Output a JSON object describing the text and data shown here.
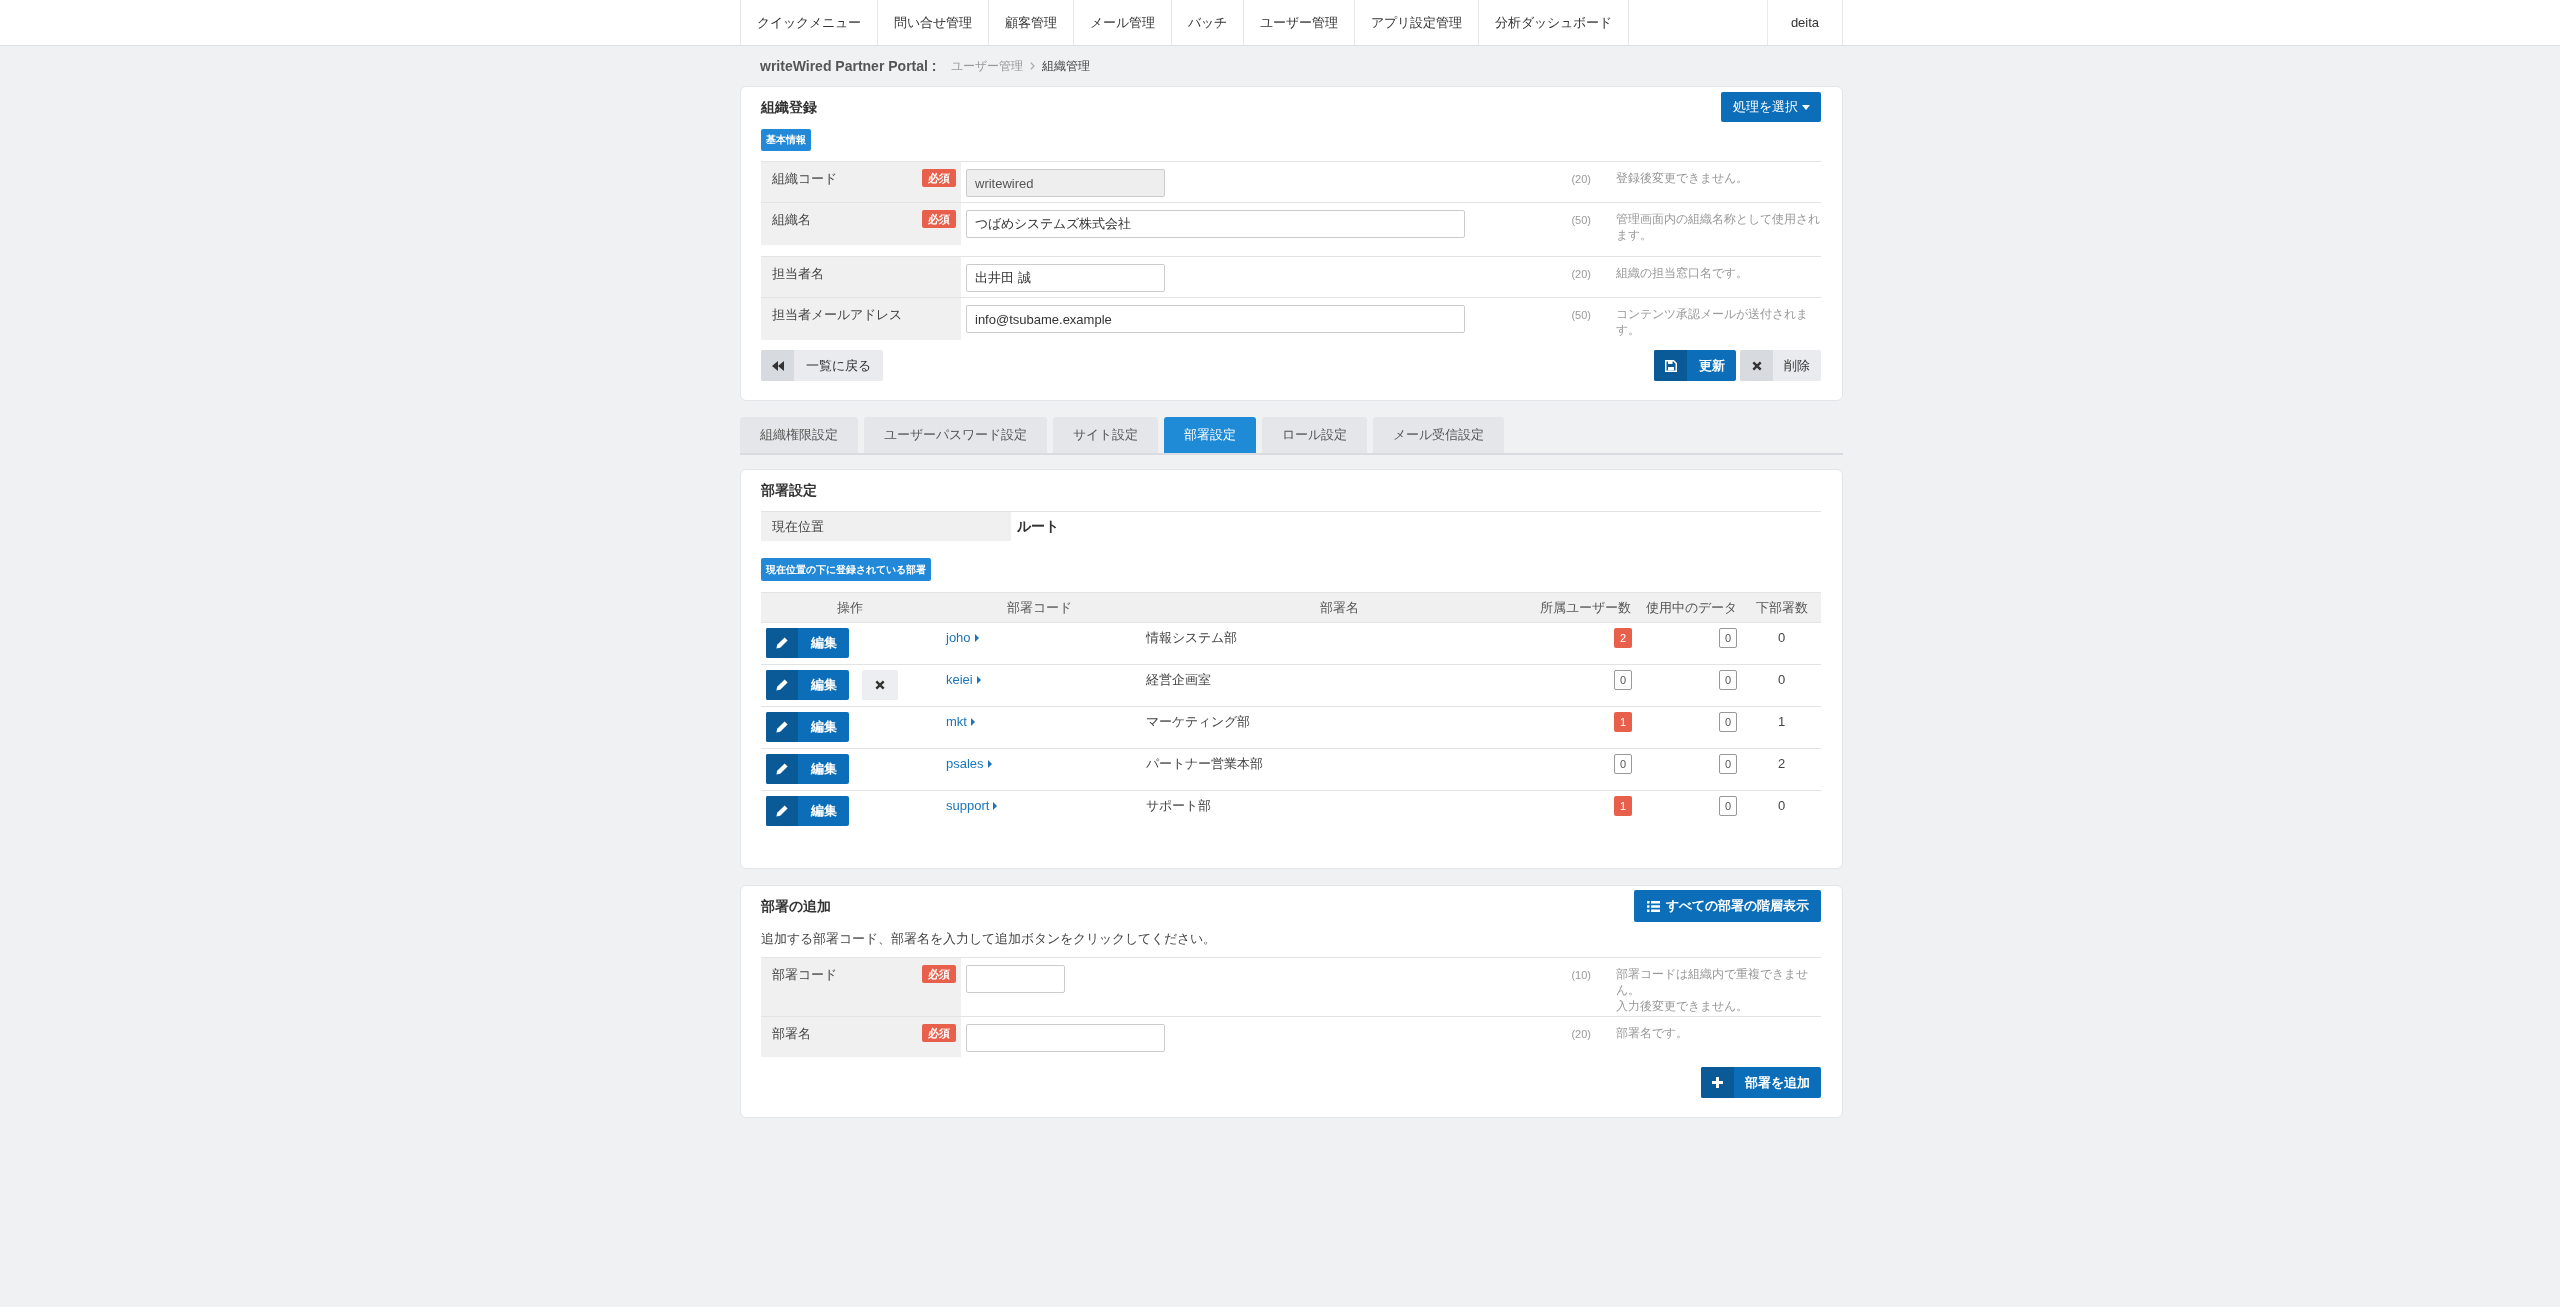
{
  "nav": {
    "items": [
      "クイックメニュー",
      "問い合せ管理",
      "顧客管理",
      "メール管理",
      "バッチ",
      "ユーザー管理",
      "アプリ設定管理",
      "分析ダッシュボード"
    ],
    "user": "deita"
  },
  "breadcrumb": {
    "portal": "writeWired Partner Portal :",
    "items": [
      {
        "label": "ユーザー管理",
        "current": false
      },
      {
        "label": "組織管理",
        "current": true
      }
    ]
  },
  "org_form": {
    "title": "組織登録",
    "action_menu": "処理を選択",
    "section_badge": "基本情報",
    "groups": [
      [
        {
          "label": "組織コード",
          "badge": "必須",
          "kind": "short",
          "value": "writewired",
          "disabled": true,
          "max": "(20)",
          "help": [
            "登録後変更できません。"
          ]
        },
        {
          "label": "組織名",
          "badge": "必須",
          "kind": "long",
          "value": "つばめシステムズ株式会社",
          "disabled": false,
          "max": "(50)",
          "help": [
            "管理画面内の組織名称として使用されます。"
          ]
        }
      ],
      [
        {
          "label": "担当者名",
          "kind": "short",
          "value": "出井田 誠",
          "disabled": false,
          "max": "(20)",
          "help": [
            "組織の担当窓口名です。"
          ]
        },
        {
          "label": "担当者メールアドレス",
          "kind": "long",
          "value": "info@tsubame.example",
          "disabled": false,
          "max": "(50)",
          "help": [
            "コンテンツ承認メールが送付されます。"
          ]
        }
      ]
    ],
    "back_button": "一覧に戻る",
    "save_button": "更新",
    "delete_button": "削除"
  },
  "tabs": [
    {
      "label": "組織権限設定",
      "selected": false
    },
    {
      "label": "ユーザーパスワード設定",
      "selected": false
    },
    {
      "label": "サイト設定",
      "selected": false
    },
    {
      "label": "部署設定",
      "selected": true
    },
    {
      "label": "ロール設定",
      "selected": false
    },
    {
      "label": "メール受信設定",
      "selected": false
    }
  ],
  "dept_section": {
    "title": "部署設定",
    "location": {
      "label": "現在位置",
      "value": "ルート"
    },
    "list_badge": "現在位置の下に登録されている部署",
    "columns": [
      "操作",
      "部署コード",
      "部署名",
      "所属ユーザー数",
      "使用中のデータ",
      "下部署数"
    ],
    "rows": [
      {
        "edit_label": "編集",
        "deletable": false,
        "code": "joho",
        "name": "情報システム部",
        "users": "2",
        "users_alert": true,
        "data": "0",
        "children": "0"
      },
      {
        "edit_label": "編集",
        "deletable": true,
        "code": "keiei",
        "name": "経営企画室",
        "users": "0",
        "users_alert": false,
        "data": "0",
        "children": "0"
      },
      {
        "edit_label": "編集",
        "deletable": false,
        "code": "mkt",
        "name": "マーケティング部",
        "users": "1",
        "users_alert": true,
        "data": "0",
        "children": "1"
      },
      {
        "edit_label": "編集",
        "deletable": false,
        "code": "psales",
        "name": "パートナー営業本部",
        "users": "0",
        "users_alert": false,
        "data": "0",
        "children": "2"
      },
      {
        "edit_label": "編集",
        "deletable": false,
        "code": "support",
        "name": "サポート部",
        "users": "1",
        "users_alert": true,
        "data": "0",
        "children": "0"
      }
    ]
  },
  "add_section": {
    "title": "部署の追加",
    "tree_button": "すべての部署の階層表示",
    "instruction": "追加する部署コード、部署名を入力して追加ボタンをクリックしてください。",
    "fields": [
      {
        "label": "部署コード",
        "badge": "必須",
        "kind": "tiny",
        "disabled": false,
        "max": "(10)",
        "help": [
          "部署コードは組織内で重複できません。",
          "入力後変更できません。"
        ]
      },
      {
        "label": "部署名",
        "badge": "必須",
        "kind": "short",
        "disabled": false,
        "max": "(20)",
        "help": [
          "部署名です。"
        ]
      }
    ],
    "add_button": "部署を追加"
  }
}
